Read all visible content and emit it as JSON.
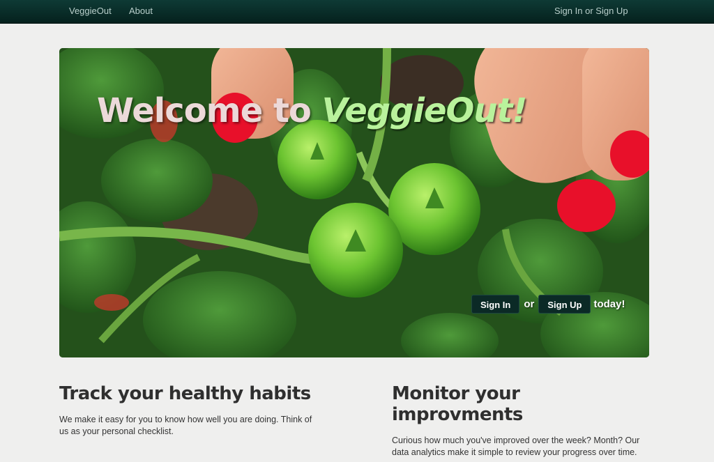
{
  "navbar": {
    "brand": "VeggieOut",
    "about": "About",
    "sign_in": "Sign In",
    "or": "or",
    "sign_up": "Sign Up"
  },
  "hero": {
    "title_prefix": "Welcome to",
    "title_brand": "VeggieOut!",
    "sign_in_label": "Sign In",
    "or_text": "or",
    "sign_up_label": "Sign Up",
    "after_text": "today!"
  },
  "features": [
    {
      "heading": "Track your healthy habits",
      "body": "We make it easy for you to know how well you are doing. Think of us as your personal checklist."
    },
    {
      "heading": "Monitor your improvments",
      "body": "Curious how much you've improved over the week? Month? Our data analytics make it simple to review your progress over time."
    }
  ],
  "colors": {
    "navbar": "#05211d",
    "button": "#0b2a26",
    "brand_green": "#b9f29c",
    "page_bg": "#efefee"
  }
}
